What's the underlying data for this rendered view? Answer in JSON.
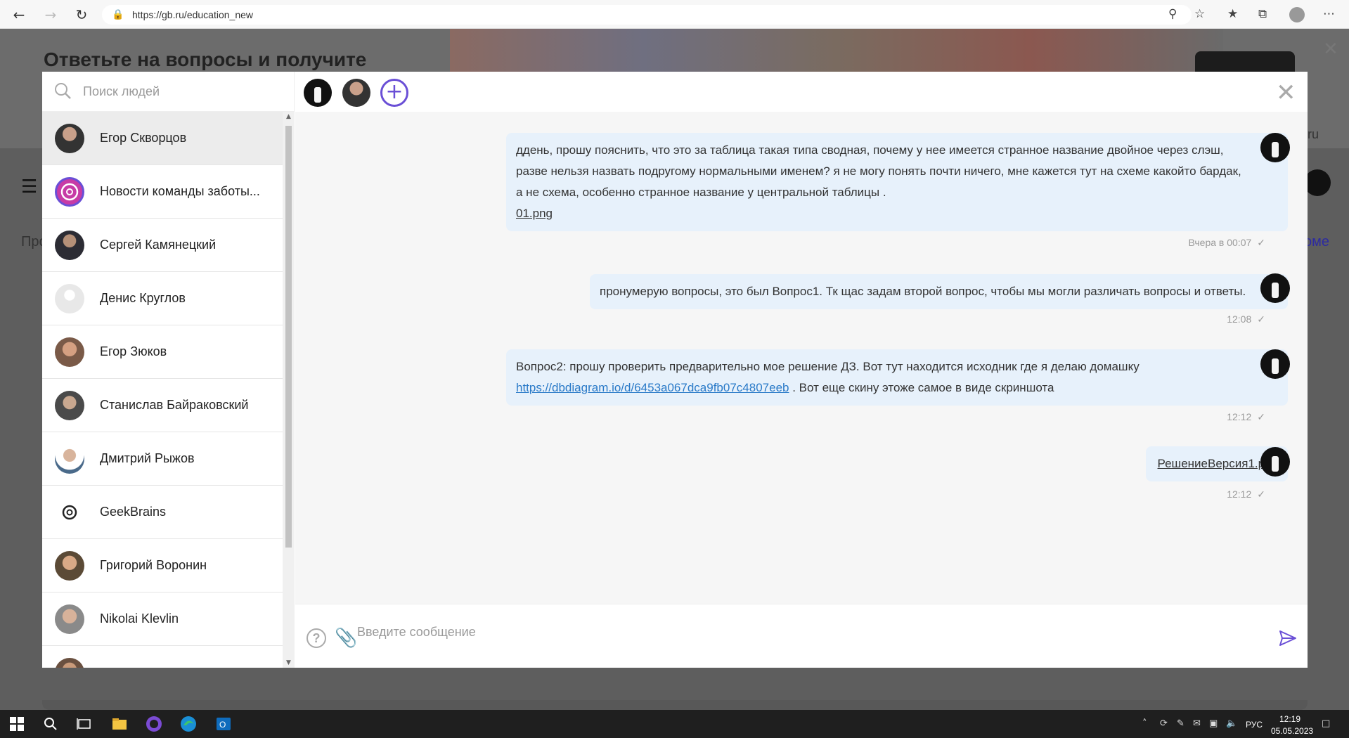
{
  "browser": {
    "url": "https://gb.ru/education_new"
  },
  "background_page": {
    "banner_title": "Ответьте на вопросы и получите",
    "left_text": "Про",
    "right_link": "оме",
    "right_small": ".ru"
  },
  "sidebar": {
    "search_placeholder": "Поиск людей",
    "contacts": [
      {
        "name": "Егор Скворцов",
        "active": true
      },
      {
        "name": "Новости команды заботы..."
      },
      {
        "name": "Сергей Камянецкий"
      },
      {
        "name": "Денис Круглов"
      },
      {
        "name": "Егор Зюков"
      },
      {
        "name": "Станислав Байраковский"
      },
      {
        "name": "Дмитрий Рыжов"
      },
      {
        "name": "GeekBrains"
      },
      {
        "name": "Григорий Воронин"
      },
      {
        "name": "Nikolai Klevlin"
      }
    ]
  },
  "chat": {
    "messages": [
      {
        "lines": [
          "ддень, прошу пояснить, что это за таблица такая типа сводная, почему у нее имеется странное название двойное через слэш,",
          "разве нельзя назвать подругому нормальными именем? я не могу понять почти ничего, мне кажется тут на схеме какойто бардак,",
          "а не схема, особенно странное название у центральной таблицы ."
        ],
        "attachment": "01.png",
        "time": "Вчера в 00:07"
      },
      {
        "text": "пронумерую вопросы, это был Вопрос1. Тк щас задам второй вопрос, чтобы мы могли различать вопросы и ответы.",
        "time": "12:08"
      },
      {
        "text": "Вопрос2: прошу проверить предварительно мое решение ДЗ. Вот тут находится исходник где я делаю домашку",
        "link": "https://dbdiagram.io/d/6453a067dca9fb07c4807eeb",
        "after_link": " . Вот еще скину этоже самое в виде скриншота",
        "time": "12:12"
      },
      {
        "attachment": "РешениеВерсия1.png",
        "time": "12:12"
      }
    ],
    "input_placeholder": "Введите сообщение"
  },
  "taskbar": {
    "lang": "РУС",
    "time": "12:19",
    "date": "05.05.2023"
  },
  "colors": {
    "accent": "#6a4fd6",
    "bubble": "#e7f1fb",
    "link": "#2a7ac8"
  }
}
